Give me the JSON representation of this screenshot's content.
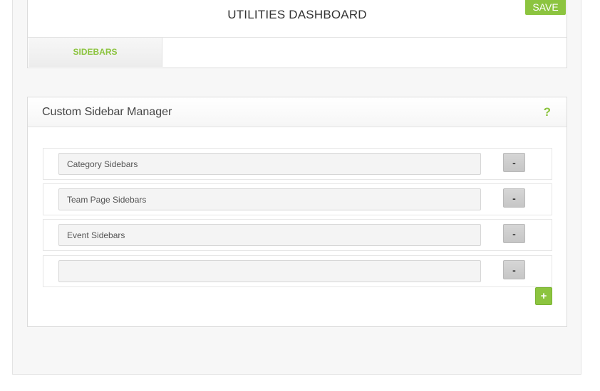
{
  "header": {
    "title": "UTILITIES DASHBOARD",
    "save_label": "SAVE"
  },
  "tabs": [
    {
      "label": "SIDEBARS",
      "active": true
    }
  ],
  "manager": {
    "title": "Custom Sidebar Manager",
    "help_glyph": "?",
    "remove_label": "-",
    "add_label": "+",
    "rows": [
      {
        "value": "Category Sidebars"
      },
      {
        "value": "Team Page Sidebars"
      },
      {
        "value": "Event Sidebars"
      },
      {
        "value": ""
      }
    ]
  },
  "colors": {
    "accent": "#8cc43f",
    "panel_border": "#dcdcdc",
    "page_background": "#f7f7f7"
  }
}
